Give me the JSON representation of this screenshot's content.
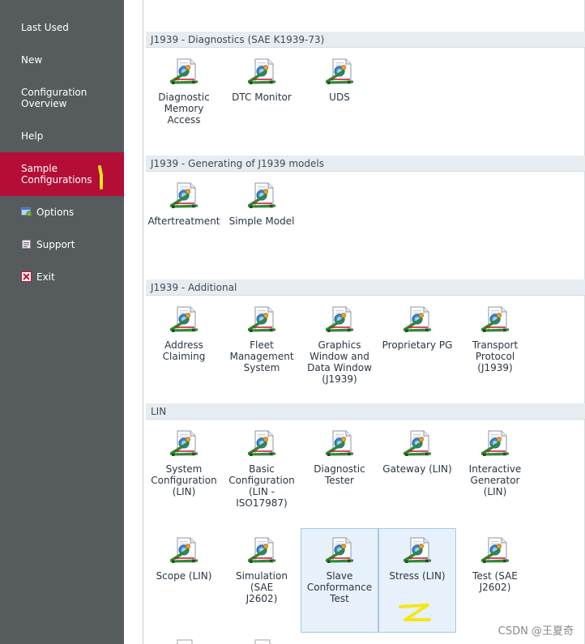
{
  "sidebar": {
    "items": [
      {
        "label": "Last Used"
      },
      {
        "label": "New"
      },
      {
        "label": "Configuration\nOverview"
      },
      {
        "label": "Help"
      },
      {
        "label": "Sample\nConfigurations"
      },
      {
        "label": "Options"
      },
      {
        "label": "Support"
      },
      {
        "label": "Exit"
      }
    ]
  },
  "groups": [
    {
      "title": "J1939 - Diagnostics (SAE K1939-73)",
      "items": [
        "Diagnostic\nMemory Access",
        "DTC Monitor",
        "UDS"
      ]
    },
    {
      "title": "J1939 - Generating of J1939 models",
      "items": [
        "Aftertreatment",
        "Simple Model"
      ]
    },
    {
      "title": "J1939 - Additional",
      "items": [
        "Address Claiming",
        "Fleet\nManagement\nSystem",
        "Graphics\nWindow and\nData Window\n(J1939)",
        "Proprietary PG",
        "Transport\nProtocol\n(J1939)"
      ]
    },
    {
      "title": "LIN",
      "items": [
        "System\nConfiguration\n(LIN)",
        "Basic\nConfiguration\n(LIN -\nISO17987)",
        "Diagnostic\nTester",
        "Gateway (LIN)",
        "Interactive\nGenerator (LIN)",
        "Scope (LIN)",
        "Simulation (SAE\nJ2602)",
        "Slave\nConformance\nTest",
        "Stress (LIN)",
        "Test (SAE\nJ2602)"
      ]
    }
  ],
  "annotations": {
    "mark1": "1",
    "mark2": "2"
  },
  "watermark": "CSDN @王夏奇",
  "colors": {
    "sidebar_bg": "#565b5e",
    "active_bg": "#b40e36",
    "header_bg": "#e7ecf1",
    "selected_tile_bg": "#e6f1fb",
    "annotation": "#f5e51b"
  },
  "icons": {
    "config_tile": "document-with-network-car-icon",
    "options": "options-icon",
    "support": "support-icon",
    "exit": "exit-icon"
  }
}
